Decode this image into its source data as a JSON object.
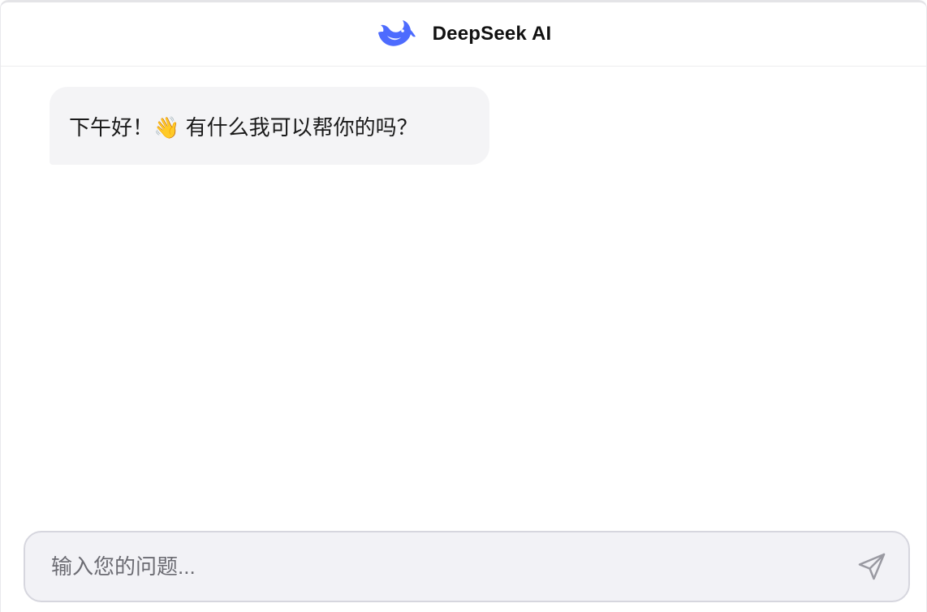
{
  "header": {
    "title": "DeepSeek AI",
    "logo_icon": "whale-logo-icon",
    "brand_color": "#4d6bfe"
  },
  "messages": [
    {
      "role": "assistant",
      "text": "下午好！👋 有什么我可以帮你的吗？"
    }
  ],
  "composer": {
    "placeholder": "输入您的问题...",
    "value": "",
    "send_icon": "send-icon"
  },
  "colors": {
    "bubble_bg": "#f4f4f6",
    "composer_bg": "#f2f2f6",
    "composer_border": "#d6d6de",
    "icon_gray": "#9a9aa2"
  }
}
